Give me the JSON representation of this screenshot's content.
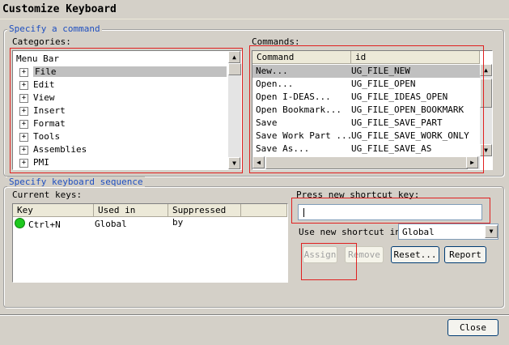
{
  "window": {
    "title": "Customize Keyboard"
  },
  "specify_command": {
    "legend": "Specify a command",
    "categories_label": "Categories:",
    "commands_label": "Commands:",
    "categories": {
      "header": "Menu Bar",
      "items": [
        "File",
        "Edit",
        "View",
        "Insert",
        "Format",
        "Tools",
        "Assemblies",
        "PMI"
      ],
      "selected_index": 0
    },
    "commands": {
      "columns": [
        "Command",
        "id"
      ],
      "rows": [
        [
          "New...",
          "UG_FILE_NEW"
        ],
        [
          "Open...",
          "UG_FILE_OPEN"
        ],
        [
          "Open I-DEAS...",
          "UG_FILE_IDEAS_OPEN"
        ],
        [
          "Open Bookmark...",
          "UG_FILE_OPEN_BOOKMARK"
        ],
        [
          "Save",
          "UG_FILE_SAVE_PART"
        ],
        [
          "Save Work Part ...",
          "UG_FILE_SAVE_WORK_ONLY"
        ],
        [
          "Save As...",
          "UG_FILE_SAVE_AS"
        ]
      ],
      "selected_index": 0
    }
  },
  "keyboard_sequence": {
    "legend": "Specify keyboard sequence",
    "current_keys_label": "Current keys:",
    "columns": [
      "Key",
      "Used in",
      "Suppressed by"
    ],
    "rows": [
      {
        "key": "Ctrl+N",
        "used_in": "Global",
        "suppressed_by": "",
        "status_color": "#1ec81e"
      }
    ],
    "press_label": "Press new shortcut key:",
    "shortcut_value": "",
    "use_in_label": "Use new shortcut in:",
    "use_in_value": "Global"
  },
  "buttons": {
    "assign": "Assign",
    "remove": "Remove",
    "reset": "Reset...",
    "report": "Report",
    "close": "Close"
  },
  "colors": {
    "highlight": "#e02020",
    "legend": "#1f4fc0",
    "status_green": "#1ec81e"
  }
}
